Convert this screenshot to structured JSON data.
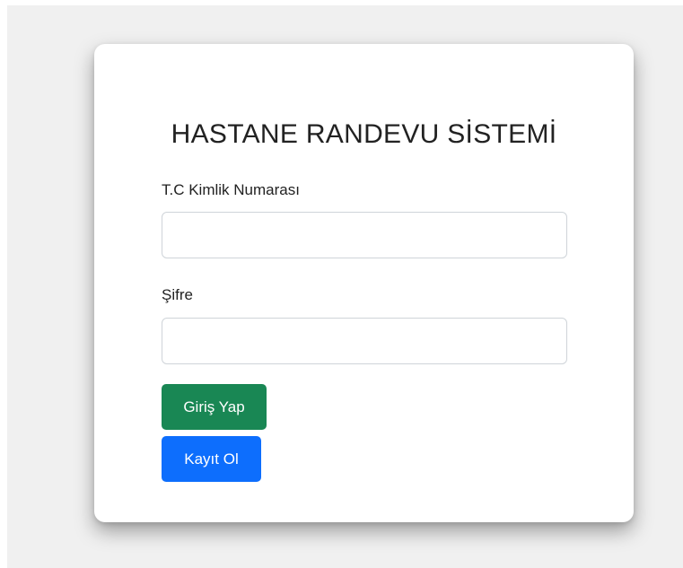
{
  "form": {
    "title": "HASTANE RANDEVU SİSTEMİ",
    "tc_label": "T.C Kimlik Numarası",
    "tc_value": "",
    "tc_placeholder": "",
    "password_label": "Şifre",
    "password_value": "",
    "password_placeholder": "",
    "login_button": "Giriş Yap",
    "register_button": "Kayıt Ol"
  },
  "colors": {
    "background": "#f0f0f0",
    "card": "#ffffff",
    "login_button": "#198754",
    "register_button": "#0d6efd",
    "text": "#222222"
  }
}
